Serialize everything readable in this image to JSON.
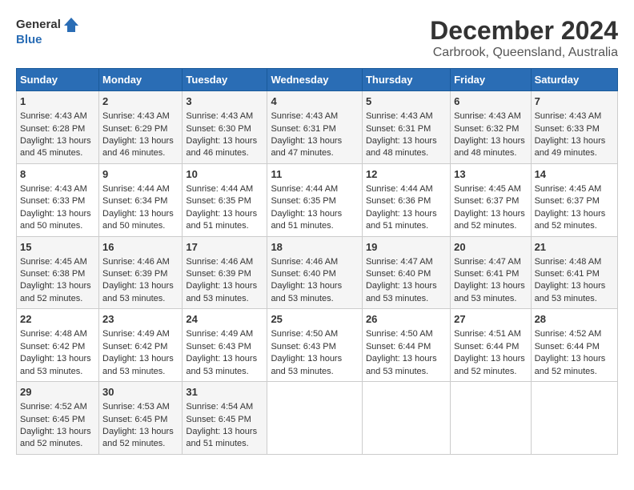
{
  "logo": {
    "line1": "General",
    "line2": "Blue"
  },
  "title": "December 2024",
  "subtitle": "Carbrook, Queensland, Australia",
  "columns": [
    "Sunday",
    "Monday",
    "Tuesday",
    "Wednesday",
    "Thursday",
    "Friday",
    "Saturday"
  ],
  "weeks": [
    [
      {
        "day": "1",
        "sunrise": "Sunrise: 4:43 AM",
        "sunset": "Sunset: 6:28 PM",
        "daylight": "Daylight: 13 hours and 45 minutes."
      },
      {
        "day": "2",
        "sunrise": "Sunrise: 4:43 AM",
        "sunset": "Sunset: 6:29 PM",
        "daylight": "Daylight: 13 hours and 46 minutes."
      },
      {
        "day": "3",
        "sunrise": "Sunrise: 4:43 AM",
        "sunset": "Sunset: 6:30 PM",
        "daylight": "Daylight: 13 hours and 46 minutes."
      },
      {
        "day": "4",
        "sunrise": "Sunrise: 4:43 AM",
        "sunset": "Sunset: 6:31 PM",
        "daylight": "Daylight: 13 hours and 47 minutes."
      },
      {
        "day": "5",
        "sunrise": "Sunrise: 4:43 AM",
        "sunset": "Sunset: 6:31 PM",
        "daylight": "Daylight: 13 hours and 48 minutes."
      },
      {
        "day": "6",
        "sunrise": "Sunrise: 4:43 AM",
        "sunset": "Sunset: 6:32 PM",
        "daylight": "Daylight: 13 hours and 48 minutes."
      },
      {
        "day": "7",
        "sunrise": "Sunrise: 4:43 AM",
        "sunset": "Sunset: 6:33 PM",
        "daylight": "Daylight: 13 hours and 49 minutes."
      }
    ],
    [
      {
        "day": "8",
        "sunrise": "Sunrise: 4:43 AM",
        "sunset": "Sunset: 6:33 PM",
        "daylight": "Daylight: 13 hours and 50 minutes."
      },
      {
        "day": "9",
        "sunrise": "Sunrise: 4:44 AM",
        "sunset": "Sunset: 6:34 PM",
        "daylight": "Daylight: 13 hours and 50 minutes."
      },
      {
        "day": "10",
        "sunrise": "Sunrise: 4:44 AM",
        "sunset": "Sunset: 6:35 PM",
        "daylight": "Daylight: 13 hours and 51 minutes."
      },
      {
        "day": "11",
        "sunrise": "Sunrise: 4:44 AM",
        "sunset": "Sunset: 6:35 PM",
        "daylight": "Daylight: 13 hours and 51 minutes."
      },
      {
        "day": "12",
        "sunrise": "Sunrise: 4:44 AM",
        "sunset": "Sunset: 6:36 PM",
        "daylight": "Daylight: 13 hours and 51 minutes."
      },
      {
        "day": "13",
        "sunrise": "Sunrise: 4:45 AM",
        "sunset": "Sunset: 6:37 PM",
        "daylight": "Daylight: 13 hours and 52 minutes."
      },
      {
        "day": "14",
        "sunrise": "Sunrise: 4:45 AM",
        "sunset": "Sunset: 6:37 PM",
        "daylight": "Daylight: 13 hours and 52 minutes."
      }
    ],
    [
      {
        "day": "15",
        "sunrise": "Sunrise: 4:45 AM",
        "sunset": "Sunset: 6:38 PM",
        "daylight": "Daylight: 13 hours and 52 minutes."
      },
      {
        "day": "16",
        "sunrise": "Sunrise: 4:46 AM",
        "sunset": "Sunset: 6:39 PM",
        "daylight": "Daylight: 13 hours and 53 minutes."
      },
      {
        "day": "17",
        "sunrise": "Sunrise: 4:46 AM",
        "sunset": "Sunset: 6:39 PM",
        "daylight": "Daylight: 13 hours and 53 minutes."
      },
      {
        "day": "18",
        "sunrise": "Sunrise: 4:46 AM",
        "sunset": "Sunset: 6:40 PM",
        "daylight": "Daylight: 13 hours and 53 minutes."
      },
      {
        "day": "19",
        "sunrise": "Sunrise: 4:47 AM",
        "sunset": "Sunset: 6:40 PM",
        "daylight": "Daylight: 13 hours and 53 minutes."
      },
      {
        "day": "20",
        "sunrise": "Sunrise: 4:47 AM",
        "sunset": "Sunset: 6:41 PM",
        "daylight": "Daylight: 13 hours and 53 minutes."
      },
      {
        "day": "21",
        "sunrise": "Sunrise: 4:48 AM",
        "sunset": "Sunset: 6:41 PM",
        "daylight": "Daylight: 13 hours and 53 minutes."
      }
    ],
    [
      {
        "day": "22",
        "sunrise": "Sunrise: 4:48 AM",
        "sunset": "Sunset: 6:42 PM",
        "daylight": "Daylight: 13 hours and 53 minutes."
      },
      {
        "day": "23",
        "sunrise": "Sunrise: 4:49 AM",
        "sunset": "Sunset: 6:42 PM",
        "daylight": "Daylight: 13 hours and 53 minutes."
      },
      {
        "day": "24",
        "sunrise": "Sunrise: 4:49 AM",
        "sunset": "Sunset: 6:43 PM",
        "daylight": "Daylight: 13 hours and 53 minutes."
      },
      {
        "day": "25",
        "sunrise": "Sunrise: 4:50 AM",
        "sunset": "Sunset: 6:43 PM",
        "daylight": "Daylight: 13 hours and 53 minutes."
      },
      {
        "day": "26",
        "sunrise": "Sunrise: 4:50 AM",
        "sunset": "Sunset: 6:44 PM",
        "daylight": "Daylight: 13 hours and 53 minutes."
      },
      {
        "day": "27",
        "sunrise": "Sunrise: 4:51 AM",
        "sunset": "Sunset: 6:44 PM",
        "daylight": "Daylight: 13 hours and 52 minutes."
      },
      {
        "day": "28",
        "sunrise": "Sunrise: 4:52 AM",
        "sunset": "Sunset: 6:44 PM",
        "daylight": "Daylight: 13 hours and 52 minutes."
      }
    ],
    [
      {
        "day": "29",
        "sunrise": "Sunrise: 4:52 AM",
        "sunset": "Sunset: 6:45 PM",
        "daylight": "Daylight: 13 hours and 52 minutes."
      },
      {
        "day": "30",
        "sunrise": "Sunrise: 4:53 AM",
        "sunset": "Sunset: 6:45 PM",
        "daylight": "Daylight: 13 hours and 52 minutes."
      },
      {
        "day": "31",
        "sunrise": "Sunrise: 4:54 AM",
        "sunset": "Sunset: 6:45 PM",
        "daylight": "Daylight: 13 hours and 51 minutes."
      },
      null,
      null,
      null,
      null
    ]
  ]
}
